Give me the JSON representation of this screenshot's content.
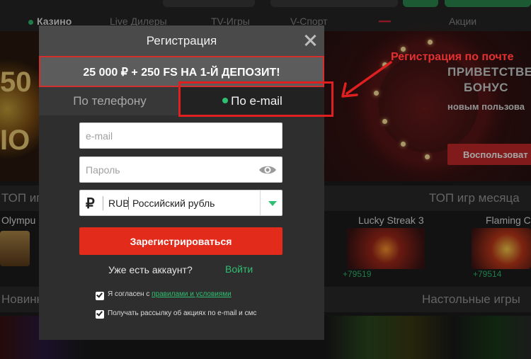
{
  "nav": {
    "items": [
      "Казино",
      "Live Дилеры",
      "TV-Игры",
      "V-Спорт",
      "Акции"
    ]
  },
  "promo": {
    "line1": "ПРИВЕТСТВЕН",
    "line2": "БОНУС",
    "sub": "новым пользова",
    "button": "Воспользоват",
    "left_big": "50",
    "left_big2": "IO"
  },
  "sections": {
    "top_left": "ТОП иг",
    "top_month": "ТОП игр месяца",
    "new_left": "Новинк",
    "table_games": "Настольные игры"
  },
  "games": [
    {
      "title": "Olympu",
      "count": ""
    },
    {
      "title": "Lucky Streak 3",
      "count": "+79519"
    },
    {
      "title": "Flaming C",
      "count": "+79514"
    }
  ],
  "modal": {
    "title": "Регистрация",
    "bonus": "25 000 ₽ + 250 FS НА 1-Й ДЕПОЗИТ!",
    "tabs": {
      "phone": "По телефону",
      "email": "По e-mail"
    },
    "email_placeholder": "e-mail",
    "password_placeholder": "Пароль",
    "currency": {
      "code": "RUB",
      "name": "Российский рубль",
      "symbol": "₽"
    },
    "register_button": "Зарегистрироваться",
    "account_question": "Уже есть аккаунт?",
    "login_link": "Войти",
    "agree_prefix": "Я согласен с ",
    "agree_link": "правилами и условиями",
    "newsletter": "Получать рассылку об акциях по e-mail и смс"
  },
  "annotation": {
    "text": "Регистрация по почте"
  },
  "colors": {
    "accent_green": "#2fbf71",
    "register_red": "#e22b1b",
    "annotation_red": "#e02020"
  }
}
